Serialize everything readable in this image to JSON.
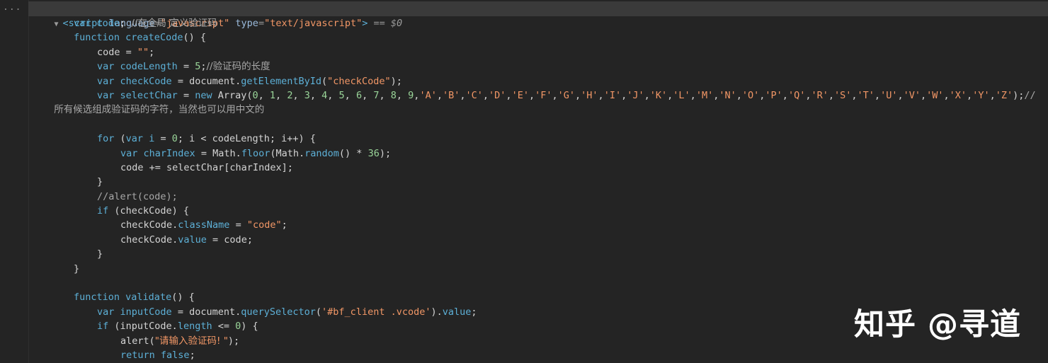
{
  "gutter": {
    "dots": "..."
  },
  "node": {
    "toggle": "▼",
    "open_tag": "<script",
    "attr1_name": "language",
    "attr1_value": "\"javascript\"",
    "attr2_name": "type",
    "attr2_value": "\"text/javascript\"",
    "close": ">",
    "eq": " == ",
    "ref": "$0"
  },
  "lines": [
    {
      "indent": 1,
      "tokens": [
        [
          "kw",
          "var"
        ],
        [
          "plain",
          " "
        ],
        [
          "id",
          "code"
        ],
        [
          "plain",
          "; "
        ],
        [
          "cm",
          "//在全局 定义验证码"
        ]
      ]
    },
    {
      "indent": 1,
      "tokens": [
        [
          "kw",
          "function"
        ],
        [
          "plain",
          " "
        ],
        [
          "fn",
          "createCode"
        ],
        [
          "plain",
          "() {"
        ]
      ]
    },
    {
      "indent": 2,
      "tokens": [
        [
          "plain",
          "code = "
        ],
        [
          "str",
          "\"\""
        ],
        [
          "plain",
          ";"
        ]
      ]
    },
    {
      "indent": 2,
      "tokens": [
        [
          "kw",
          "var"
        ],
        [
          "plain",
          " "
        ],
        [
          "id",
          "codeLength"
        ],
        [
          "plain",
          " = "
        ],
        [
          "num",
          "5"
        ],
        [
          "plain",
          ";"
        ],
        [
          "cm",
          "//验证码的长度"
        ]
      ]
    },
    {
      "indent": 2,
      "tokens": [
        [
          "kw",
          "var"
        ],
        [
          "plain",
          " "
        ],
        [
          "id",
          "checkCode"
        ],
        [
          "plain",
          " = document."
        ],
        [
          "fn",
          "getElementById"
        ],
        [
          "plain",
          "("
        ],
        [
          "str",
          "\"checkCode\""
        ],
        [
          "plain",
          ");"
        ]
      ]
    },
    {
      "indent": 2,
      "tokens": [
        [
          "kw",
          "var"
        ],
        [
          "plain",
          " "
        ],
        [
          "id",
          "selectChar"
        ],
        [
          "plain",
          " = "
        ],
        [
          "kw",
          "new"
        ],
        [
          "plain",
          " Array("
        ],
        [
          "num",
          "0"
        ],
        [
          "plain",
          ", "
        ],
        [
          "num",
          "1"
        ],
        [
          "plain",
          ", "
        ],
        [
          "num",
          "2"
        ],
        [
          "plain",
          ", "
        ],
        [
          "num",
          "3"
        ],
        [
          "plain",
          ", "
        ],
        [
          "num",
          "4"
        ],
        [
          "plain",
          ", "
        ],
        [
          "num",
          "5"
        ],
        [
          "plain",
          ", "
        ],
        [
          "num",
          "6"
        ],
        [
          "plain",
          ", "
        ],
        [
          "num",
          "7"
        ],
        [
          "plain",
          ", "
        ],
        [
          "num",
          "8"
        ],
        [
          "plain",
          ", "
        ],
        [
          "num",
          "9"
        ],
        [
          "plain",
          ","
        ],
        [
          "str",
          "'A'"
        ],
        [
          "plain",
          ","
        ],
        [
          "str",
          "'B'"
        ],
        [
          "plain",
          ","
        ],
        [
          "str",
          "'C'"
        ],
        [
          "plain",
          ","
        ],
        [
          "str",
          "'D'"
        ],
        [
          "plain",
          ","
        ],
        [
          "str",
          "'E'"
        ],
        [
          "plain",
          ","
        ],
        [
          "str",
          "'F'"
        ],
        [
          "plain",
          ","
        ],
        [
          "str",
          "'G'"
        ],
        [
          "plain",
          ","
        ],
        [
          "str",
          "'H'"
        ],
        [
          "plain",
          ","
        ],
        [
          "str",
          "'I'"
        ],
        [
          "plain",
          ","
        ],
        [
          "str",
          "'J'"
        ],
        [
          "plain",
          ","
        ],
        [
          "str",
          "'K'"
        ],
        [
          "plain",
          ","
        ],
        [
          "str",
          "'L'"
        ],
        [
          "plain",
          ","
        ],
        [
          "str",
          "'M'"
        ],
        [
          "plain",
          ","
        ],
        [
          "str",
          "'N'"
        ],
        [
          "plain",
          ","
        ],
        [
          "str",
          "'O'"
        ],
        [
          "plain",
          ","
        ],
        [
          "str",
          "'P'"
        ],
        [
          "plain",
          ","
        ],
        [
          "str",
          "'Q'"
        ],
        [
          "plain",
          ","
        ],
        [
          "str",
          "'R'"
        ],
        [
          "plain",
          ","
        ],
        [
          "str",
          "'S'"
        ],
        [
          "plain",
          ","
        ],
        [
          "str",
          "'T'"
        ],
        [
          "plain",
          ","
        ],
        [
          "str",
          "'U'"
        ],
        [
          "plain",
          ","
        ],
        [
          "str",
          "'V'"
        ],
        [
          "plain",
          ","
        ],
        [
          "str",
          "'W'"
        ],
        [
          "plain",
          ","
        ],
        [
          "str",
          "'X'"
        ],
        [
          "plain",
          ","
        ],
        [
          "str",
          "'Y'"
        ],
        [
          "plain",
          ","
        ],
        [
          "str",
          "'Z'"
        ],
        [
          "plain",
          ");"
        ],
        [
          "cm",
          "//"
        ]
      ]
    },
    {
      "indent": 0,
      "tokens": [
        [
          "cm",
          " 所有候选组成验证码的字符，当然也可以用中文的"
        ]
      ]
    },
    {
      "indent": 0,
      "tokens": []
    },
    {
      "indent": 2,
      "tokens": [
        [
          "kw",
          "for"
        ],
        [
          "plain",
          " ("
        ],
        [
          "kw",
          "var"
        ],
        [
          "plain",
          " "
        ],
        [
          "id",
          "i"
        ],
        [
          "plain",
          " = "
        ],
        [
          "num",
          "0"
        ],
        [
          "plain",
          "; i < codeLength; i++) {"
        ]
      ]
    },
    {
      "indent": 3,
      "tokens": [
        [
          "kw",
          "var"
        ],
        [
          "plain",
          " "
        ],
        [
          "id",
          "charIndex"
        ],
        [
          "plain",
          " = Math."
        ],
        [
          "fn",
          "floor"
        ],
        [
          "plain",
          "(Math."
        ],
        [
          "fn",
          "random"
        ],
        [
          "plain",
          "() * "
        ],
        [
          "num",
          "36"
        ],
        [
          "plain",
          ");"
        ]
      ]
    },
    {
      "indent": 3,
      "tokens": [
        [
          "plain",
          "code += selectChar[charIndex];"
        ]
      ]
    },
    {
      "indent": 2,
      "tokens": [
        [
          "plain",
          "}"
        ]
      ]
    },
    {
      "indent": 2,
      "tokens": [
        [
          "cm",
          "//alert(code);"
        ]
      ]
    },
    {
      "indent": 2,
      "tokens": [
        [
          "kw",
          "if"
        ],
        [
          "plain",
          " (checkCode) {"
        ]
      ]
    },
    {
      "indent": 3,
      "tokens": [
        [
          "plain",
          "checkCode."
        ],
        [
          "prop",
          "className"
        ],
        [
          "plain",
          " = "
        ],
        [
          "str",
          "\"code\""
        ],
        [
          "plain",
          ";"
        ]
      ]
    },
    {
      "indent": 3,
      "tokens": [
        [
          "plain",
          "checkCode."
        ],
        [
          "prop",
          "value"
        ],
        [
          "plain",
          " = code;"
        ]
      ]
    },
    {
      "indent": 2,
      "tokens": [
        [
          "plain",
          "}"
        ]
      ]
    },
    {
      "indent": 1,
      "tokens": [
        [
          "plain",
          "}"
        ]
      ]
    },
    {
      "indent": 0,
      "tokens": []
    },
    {
      "indent": 1,
      "tokens": [
        [
          "kw",
          "function"
        ],
        [
          "plain",
          " "
        ],
        [
          "fn",
          "validate"
        ],
        [
          "plain",
          "() {"
        ]
      ]
    },
    {
      "indent": 2,
      "tokens": [
        [
          "kw",
          "var"
        ],
        [
          "plain",
          " "
        ],
        [
          "id",
          "inputCode"
        ],
        [
          "plain",
          " = document."
        ],
        [
          "fn",
          "querySelector"
        ],
        [
          "plain",
          "("
        ],
        [
          "str",
          "'#bf_client .vcode'"
        ],
        [
          "plain",
          ")."
        ],
        [
          "prop",
          "value"
        ],
        [
          "plain",
          ";"
        ]
      ]
    },
    {
      "indent": 2,
      "tokens": [
        [
          "kw",
          "if"
        ],
        [
          "plain",
          " (inputCode."
        ],
        [
          "prop",
          "length"
        ],
        [
          "plain",
          " <= "
        ],
        [
          "num",
          "0"
        ],
        [
          "plain",
          ") {"
        ]
      ]
    },
    {
      "indent": 3,
      "tokens": [
        [
          "plain",
          "alert("
        ],
        [
          "str",
          "\"请输入验证码! \""
        ],
        [
          "plain",
          ");"
        ]
      ]
    },
    {
      "indent": 3,
      "tokens": [
        [
          "kw",
          "return"
        ],
        [
          "plain",
          " "
        ],
        [
          "kw",
          "false"
        ],
        [
          "plain",
          ";"
        ]
      ]
    }
  ],
  "watermark": "知乎 @寻道"
}
